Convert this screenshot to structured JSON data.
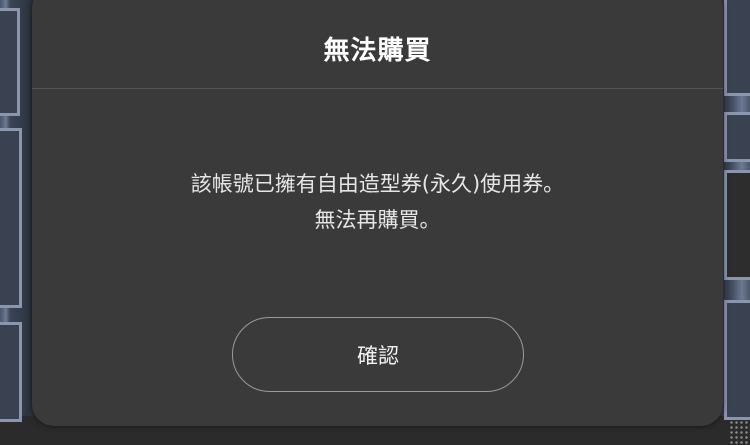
{
  "dialog": {
    "title": "無法購買",
    "message_lines": [
      "該帳號已擁有自由造型券(永久)使用券。",
      "無法再購買。"
    ],
    "confirm_label": "確認"
  },
  "colors": {
    "dialog_bg": "#3a3a3a",
    "title_text": "#ffffff",
    "body_text": "#e6e6e6",
    "button_border": "#9a9a9a"
  }
}
